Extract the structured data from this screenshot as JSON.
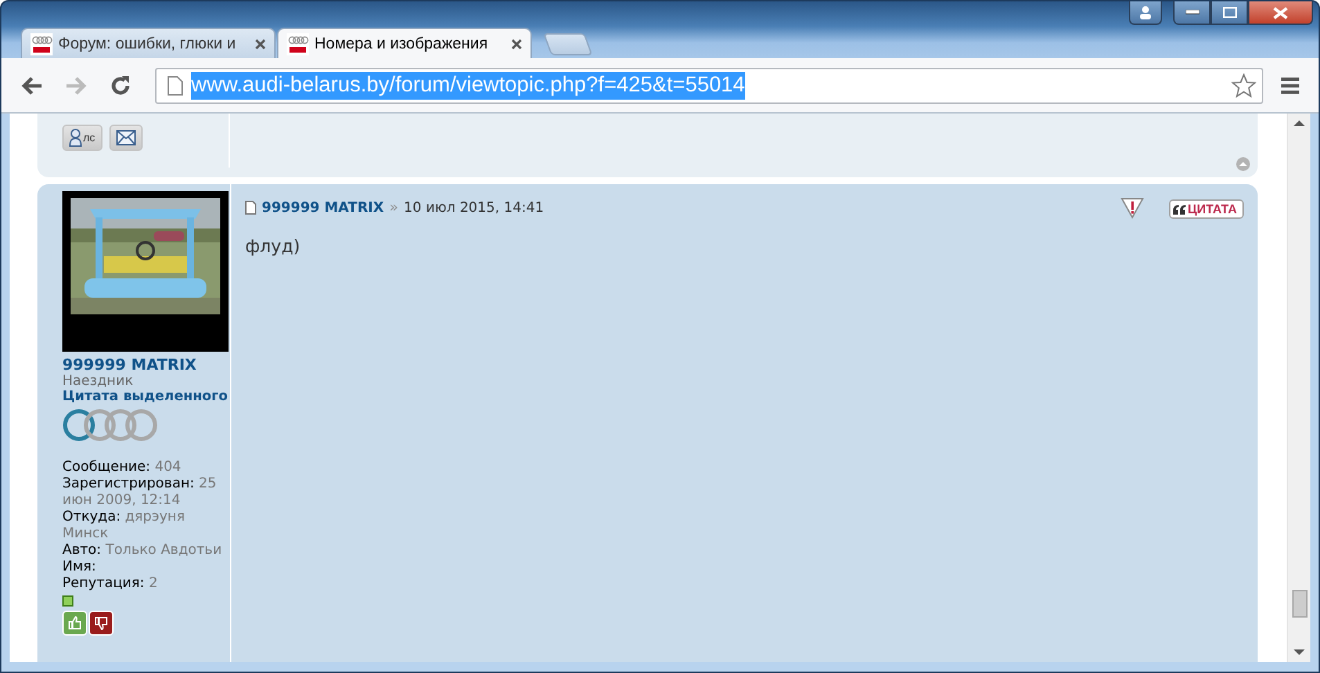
{
  "tabs": [
    {
      "title": "Форум: ошибки, глюки и",
      "selected": false
    },
    {
      "title": "Номера и изображения",
      "selected": true
    }
  ],
  "address_bar": {
    "url": "www.audi-belarus.by/forum/viewtopic.php?f=425&t=55014",
    "selected": true
  },
  "previous_post": {
    "pm_button": "лс"
  },
  "post": {
    "author": "999999 MATRIX",
    "rank": "Наездник",
    "rank_title": "Цитата выделенного",
    "profile": [
      {
        "label": "Сообщение:",
        "value": "404"
      },
      {
        "label": "Зарегистрирован:",
        "value": "25 июн 2009, 12:14"
      },
      {
        "label": "Откуда:",
        "value": "дярэуня Минск"
      },
      {
        "label": "Авто:",
        "value": "Только Авдотьи"
      },
      {
        "label": "Имя:"
      },
      {
        "label": "Репутация:",
        "value": "2"
      }
    ],
    "header_author": "999999 MATRIX",
    "separator": "»",
    "date": "10 июл 2015, 14:41",
    "body": "флуд)",
    "quote_button": "ЦИТАТА"
  }
}
